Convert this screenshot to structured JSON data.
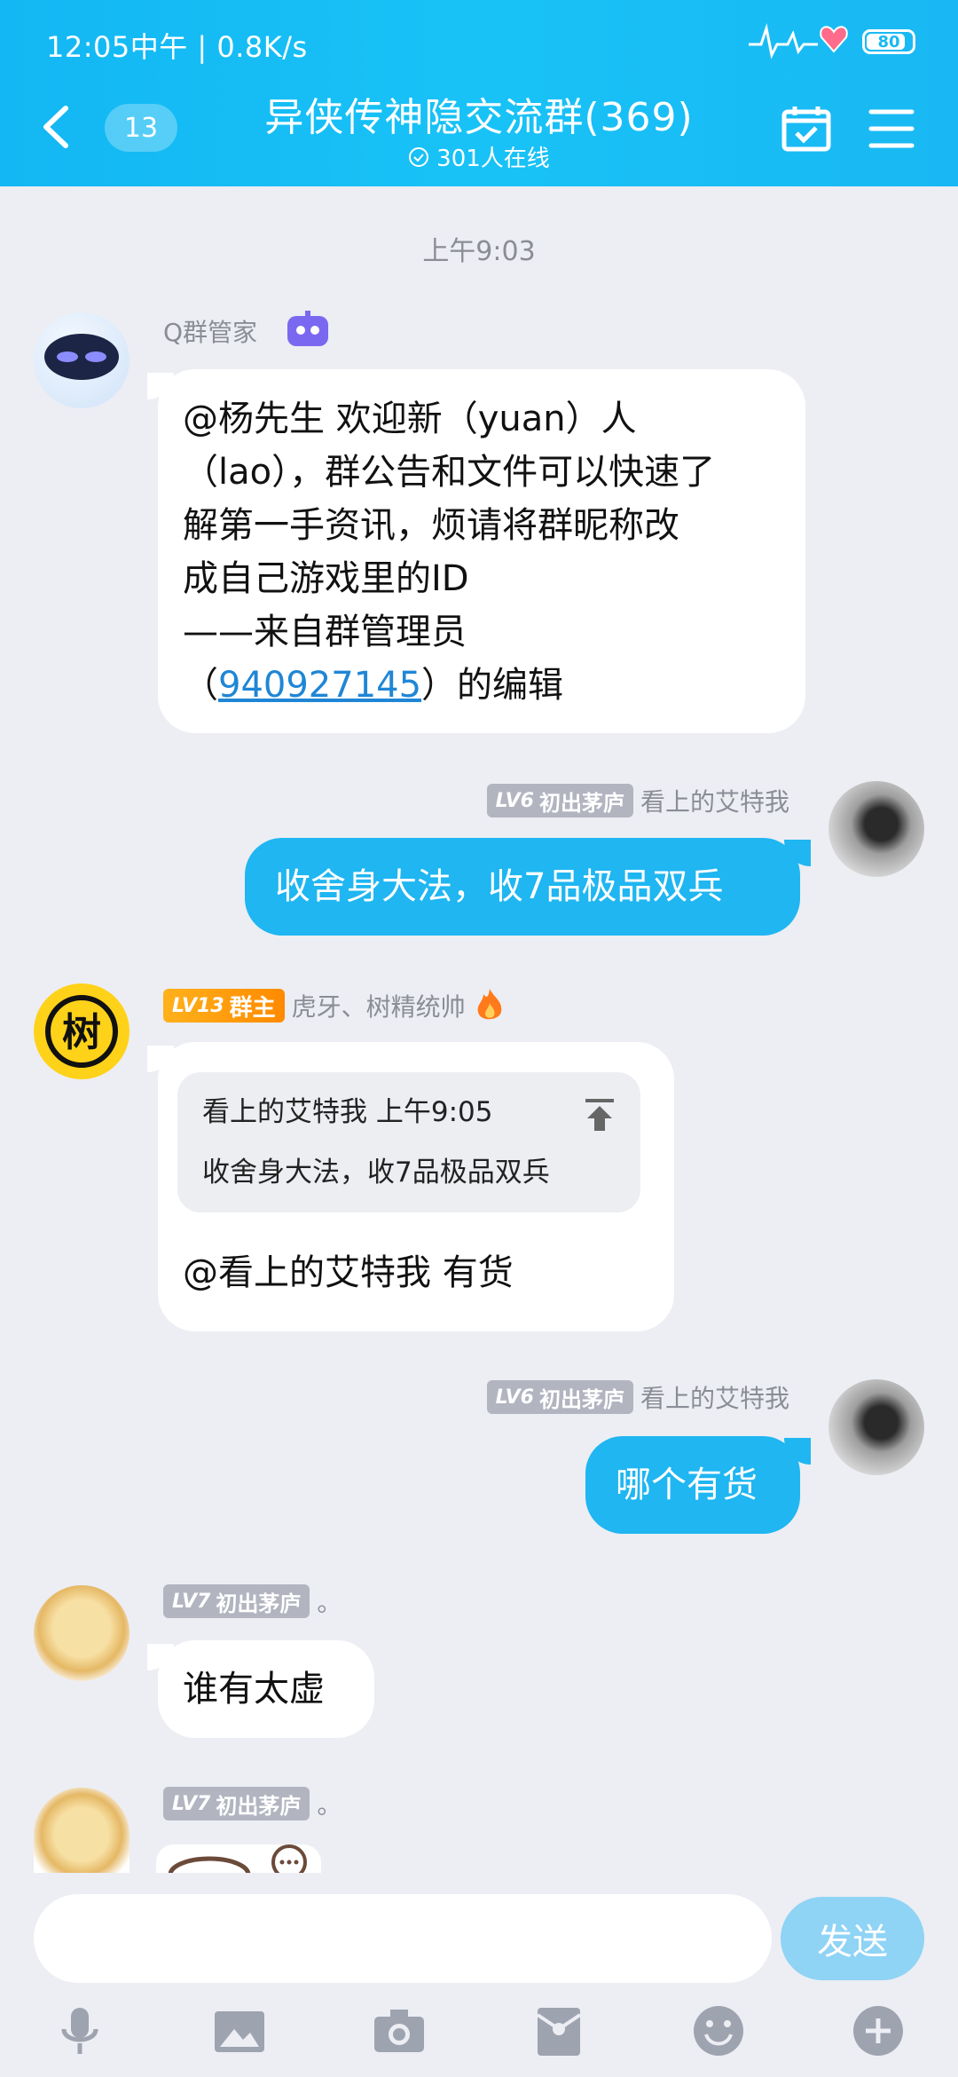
{
  "status_bar": {
    "time_speed": "12:05中午 | 0.8K/s",
    "battery": "80"
  },
  "header": {
    "unread_count": "13",
    "title": "异侠传神隐交流群(369)",
    "online": "301人在线"
  },
  "chat": {
    "time_separator": "上午9:03",
    "messages": [
      {
        "sender": "Q群管家",
        "lines": [
          "@杨先生 欢迎新（yuan）人",
          "（lao），群公告和文件可以快速了",
          "解第一手资讯，烦请将群昵称改",
          "成自己游戏里的ID",
          "——来自群管理员"
        ],
        "last_pre": "（",
        "link": "940927145",
        "last_post": "）的编辑"
      },
      {
        "badge_lv": "LV6",
        "badge_title": "初出茅庐",
        "sender": "看上的艾特我",
        "text": "收舍身大法，收7品极品双兵"
      },
      {
        "badge_lv": "LV13",
        "badge_title": "群主",
        "sender": "虎牙、树精统帅",
        "avatar_char": "树",
        "quote_header": "看上的艾特我  上午9:05",
        "quote_text": "收舍身大法，收7品极品双兵",
        "text": "@看上的艾特我 有货"
      },
      {
        "badge_lv": "LV6",
        "badge_title": "初出茅庐",
        "sender": "看上的艾特我",
        "text": "哪个有货"
      },
      {
        "badge_lv": "LV7",
        "badge_title": "初出茅庐",
        "sender": "。",
        "text": "谁有太虚"
      },
      {
        "badge_lv": "LV7",
        "badge_title": "初出茅庐",
        "sender": "。"
      }
    ]
  },
  "input": {
    "placeholder": "",
    "send_label": "发送"
  },
  "toolbar": [
    "microphone-icon",
    "image-icon",
    "camera-icon",
    "red-packet-icon",
    "emoji-icon",
    "plus-icon"
  ],
  "colors": {
    "header": "#18c2f6",
    "bubble_self": "#1fb6f1",
    "background": "#eceef3",
    "send_button": "#8fd3f5"
  }
}
